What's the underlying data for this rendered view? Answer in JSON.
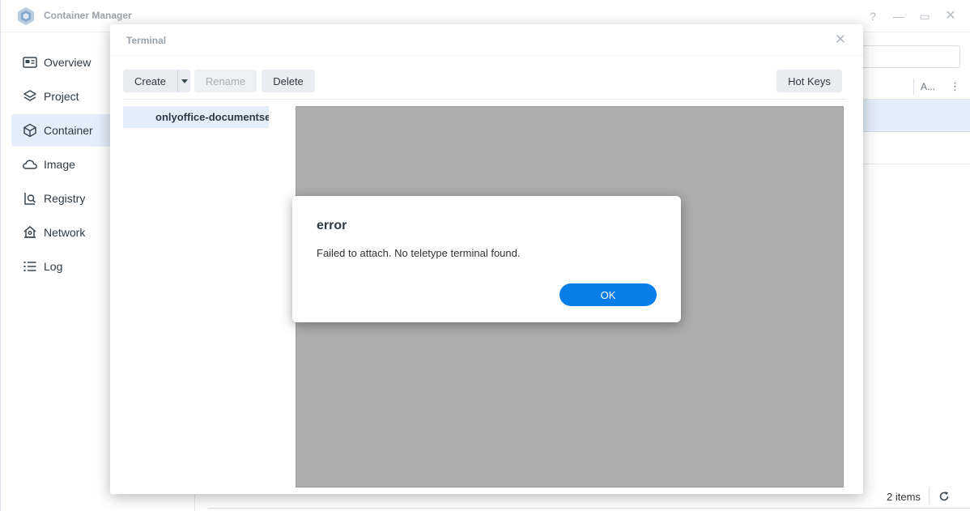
{
  "app": {
    "title": "Container Manager",
    "window_controls": {
      "help": "?",
      "minimize": "—",
      "maximize": "▭",
      "close": "✕"
    }
  },
  "sidebar": {
    "items": [
      {
        "label": "Overview",
        "icon": "overview-icon"
      },
      {
        "label": "Project",
        "icon": "project-layers-icon"
      },
      {
        "label": "Container",
        "icon": "container-cube-icon",
        "active": true
      },
      {
        "label": "Image",
        "icon": "image-cloud-icon"
      },
      {
        "label": "Registry",
        "icon": "registry-search-icon"
      },
      {
        "label": "Network",
        "icon": "network-house-icon"
      },
      {
        "label": "Log",
        "icon": "log-list-icon"
      }
    ]
  },
  "main": {
    "column_header_truncated": "A...",
    "column_menu": "⋮",
    "footer": {
      "items_count": "2 items"
    }
  },
  "terminal": {
    "title": "Terminal",
    "close": "✕",
    "toolbar": {
      "create": "Create",
      "rename": "Rename",
      "delete": "Delete",
      "hot_keys": "Hot Keys"
    },
    "sessions": [
      {
        "label": "onlyoffice-documentse"
      }
    ]
  },
  "error_dialog": {
    "title": "error",
    "message": "Failed to attach. No teletype terminal found.",
    "ok": "OK"
  },
  "colors": {
    "accent": "#0a7ee8",
    "selection": "#e4eefa",
    "terminal_bg": "#adadad",
    "button_bg": "#e9edf2"
  }
}
